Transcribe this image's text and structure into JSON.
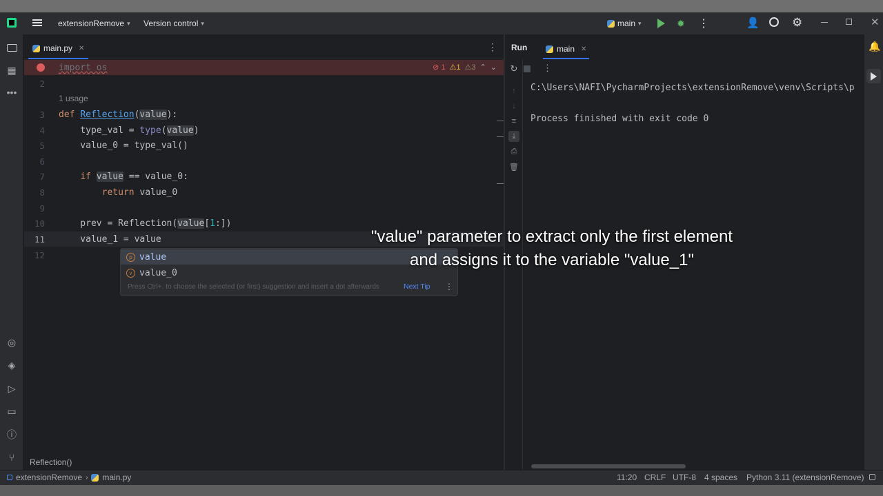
{
  "titlebar": {
    "project": "extensionRemove",
    "vcs": "Version control",
    "run_config": "main"
  },
  "editor": {
    "tab_label": "main.py",
    "lines": [
      {
        "n": "1"
      },
      {
        "n": "2"
      },
      {
        "n": "3"
      },
      {
        "n": "4"
      },
      {
        "n": "5"
      },
      {
        "n": "6"
      },
      {
        "n": "7"
      },
      {
        "n": "8"
      },
      {
        "n": "9"
      },
      {
        "n": "10"
      },
      {
        "n": "11"
      },
      {
        "n": "12"
      }
    ],
    "usage_hint": "1 usage",
    "inspections": {
      "errors": "1",
      "warnings": "1",
      "weak": "3"
    },
    "breadcrumb": "Reflection()"
  },
  "completion": {
    "items": [
      "value",
      "value_0"
    ],
    "hint": "Press Ctrl+. to choose the selected (or first) suggestion and insert a dot afterwards",
    "tip": "Next Tip"
  },
  "run": {
    "tab_run": "Run",
    "tab_config": "main",
    "console_line1": "C:\\Users\\NAFI\\PycharmProjects\\extensionRemove\\venv\\Scripts\\p",
    "console_line2": "Process finished with exit code 0"
  },
  "status": {
    "project": "extensionRemove",
    "file": "main.py",
    "position": "11:20",
    "line_sep": "CRLF",
    "encoding": "UTF-8",
    "indent": "4 spaces",
    "interpreter": "Python 3.11 (extensionRemove)"
  },
  "subtitle": {
    "line1": "\"value\" parameter to extract only the first element",
    "line2": "and assigns it to the variable \"value_1\""
  }
}
